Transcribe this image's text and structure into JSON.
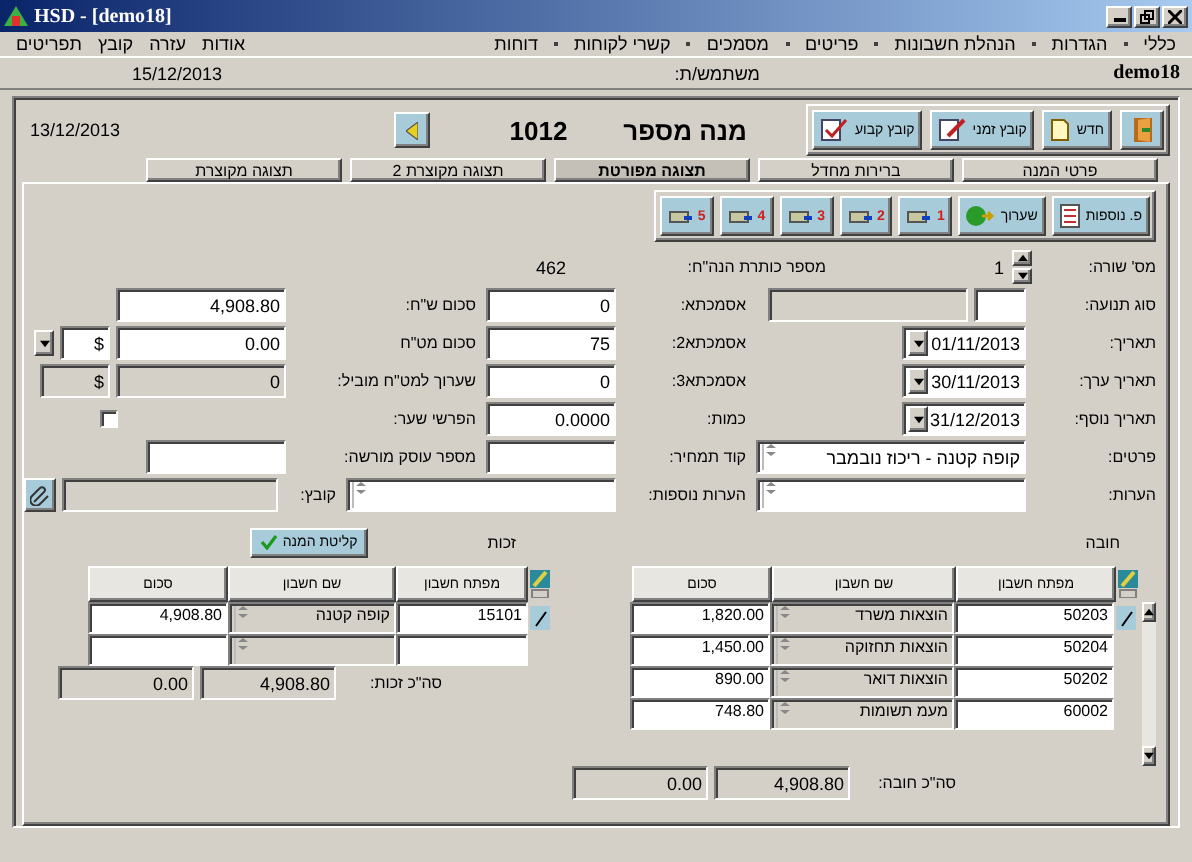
{
  "window": {
    "title": "HSD - [demo18]"
  },
  "menu_right": [
    "כללי",
    "הגדרות",
    "הנהלת חשבונות",
    "פריטים",
    "מסמכים",
    "קשרי לקוחות",
    "דוחות"
  ],
  "menu_left": [
    "אודות",
    "עזרה",
    "קובץ",
    "תפריטים"
  ],
  "info_bar": {
    "date": "15/12/2013",
    "user_label": "משתמש/ת:",
    "company": "demo18"
  },
  "header": {
    "date": "13/12/2013",
    "batch_label": "מנה מספר",
    "batch_number": "1012"
  },
  "toolbar": [
    {
      "kind": "exit"
    },
    {
      "kind": "new",
      "label": "חדש"
    },
    {
      "kind": "temp",
      "label": "קובץ זמני"
    },
    {
      "kind": "fixed",
      "label": "קובץ קבוע"
    }
  ],
  "tabs": [
    {
      "label": "פרטי המנה",
      "selected": false
    },
    {
      "label": "ברירות מחדל",
      "selected": false
    },
    {
      "label": "תצוגה מפורטת",
      "selected": true
    },
    {
      "label": "תצוגה מקוצרת 2",
      "selected": false
    },
    {
      "label": "תצוגה מקוצרת",
      "selected": false
    }
  ],
  "line_toolbar": [
    {
      "kind": "extra",
      "label": "פ. נוספות"
    },
    {
      "kind": "revalue",
      "label": "שערוך"
    },
    {
      "kind": "print",
      "label": "1"
    },
    {
      "kind": "print",
      "label": "2"
    },
    {
      "kind": "print",
      "label": "3"
    },
    {
      "kind": "print",
      "label": "4"
    },
    {
      "kind": "print",
      "label": "5"
    }
  ],
  "line_number": {
    "label": "מס' שורה:",
    "value": "1"
  },
  "header_ref": {
    "label": "מספר כותרת הנה\"ח:",
    "value": "462"
  },
  "right_fields": [
    {
      "label": "סוג תנועה:",
      "kind": "type"
    },
    {
      "label": "תאריך:",
      "kind": "date",
      "value": "01/11/2013"
    },
    {
      "label": "תאריך ערך:",
      "kind": "date",
      "value": "30/11/2013"
    },
    {
      "label": "תאריך נוסף:",
      "kind": "date",
      "value": "31/12/2013"
    },
    {
      "label": "פרטים:",
      "kind": "memo",
      "value": "קופה קטנה - ריכוז נובמבר"
    },
    {
      "label": "הערות:",
      "kind": "memo"
    }
  ],
  "middle_fields": [
    {
      "label": "אסמכתא:",
      "kind": "text",
      "value": "0"
    },
    {
      "label": "אסמכתא2:",
      "kind": "text",
      "value": "75"
    },
    {
      "label": "אסמכתא3:",
      "kind": "text",
      "value": "0"
    },
    {
      "label": "כמות:",
      "kind": "text",
      "value": "0.0000"
    },
    {
      "label": "קוד תמחיר:",
      "kind": "text"
    },
    {
      "label": "הערות נוספות:",
      "kind": "memo"
    }
  ],
  "left_fields": [
    {
      "label": "סכום ש\"ח:",
      "kind": "amount",
      "value": "4,908.80"
    },
    {
      "label": "סכום מט\"ח",
      "kind": "currency",
      "value": "0.00",
      "currency": "$"
    },
    {
      "label": "שערוך למט\"ח מוביל:",
      "kind": "currency_readonly",
      "value": "0",
      "currency": "$"
    },
    {
      "label": "הפרשי שער:",
      "kind": "checkbox",
      "checked": false
    },
    {
      "label": "מספר עוסק מורשה:",
      "kind": "short"
    },
    {
      "label": "קובץ:",
      "kind": "file"
    }
  ],
  "accept_button": {
    "label": "קליטת המנה"
  },
  "debit": {
    "title": "חובה",
    "columns": [
      "מפתח חשבון",
      "שם חשבון",
      "סכום"
    ],
    "rows": [
      {
        "account": "50203",
        "name": "הוצאות משרד",
        "amount": "1,820.00"
      },
      {
        "account": "50204",
        "name": "הוצאות תחזוקה",
        "amount": "1,450.00"
      },
      {
        "account": "50202",
        "name": "הוצאות דואר",
        "amount": "890.00"
      },
      {
        "account": "60002",
        "name": "מעמ תשומות",
        "amount": "748.80"
      }
    ],
    "scrollbar": true,
    "total_label": "סה\"כ חובה:",
    "totals": [
      "4,908.80",
      "0.00"
    ]
  },
  "credit": {
    "title": "זכות",
    "columns": [
      "מפתח חשבון",
      "שם חשבון",
      "סכום"
    ],
    "rows": [
      {
        "account": "15101",
        "name": "קופה קטנה",
        "amount": "4,908.80"
      }
    ],
    "new_row": true,
    "total_label": "סה\"כ זכות:",
    "totals": [
      "4,908.80",
      "0.00"
    ]
  }
}
